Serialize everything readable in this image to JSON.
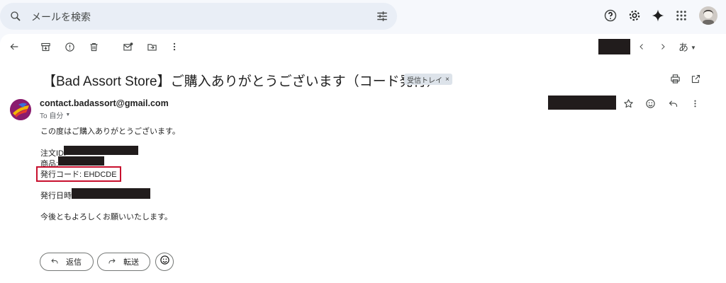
{
  "search": {
    "placeholder": "メールを検索"
  },
  "toolbar": {
    "lang": "あ"
  },
  "email": {
    "subject": "【Bad Assort Store】ご購入ありがとうございます（コード発行）",
    "label": "受信トレイ",
    "label_close": "×",
    "sender": "contact.badassort@gmail.com",
    "to": "To 自分",
    "greeting": "この度はご購入ありがとうございます。",
    "order_id_label": "注文ID:",
    "product_label": "商品:",
    "code_line": "発行コード: EHDCDE",
    "issue_date_label": "発行日時:",
    "closing": "今後ともよろしくお願いいたします。"
  },
  "actions": {
    "reply": "返信",
    "forward": "転送"
  },
  "colors": {
    "highlight_border": "#c8102e",
    "redaction": "#211c1c"
  },
  "icons": [
    "search-icon",
    "tune-icon",
    "help-icon",
    "settings-icon",
    "gemini-icon",
    "apps-icon",
    "back-icon",
    "archive-icon",
    "report-icon",
    "delete-icon",
    "mark-unread-icon",
    "move-icon",
    "more-icon",
    "prev-icon",
    "next-icon",
    "print-icon",
    "open-new-window-icon",
    "star-icon",
    "emoji-icon",
    "reply-icon",
    "forward-icon"
  ]
}
